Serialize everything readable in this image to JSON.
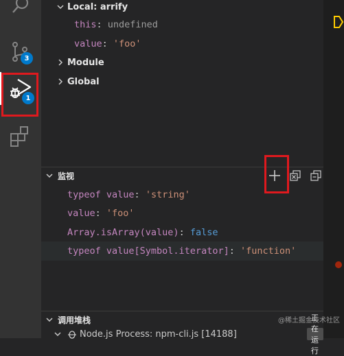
{
  "activity_bar": {
    "run_debug_badge": "1",
    "scm_badge": "3"
  },
  "variables": {
    "local_scope": "Local: arrify",
    "items": [
      {
        "name": "this",
        "sep": ": ",
        "value": "undefined"
      },
      {
        "name": "value",
        "sep": ": ",
        "value": "'foo'"
      }
    ],
    "module_scope": "Module",
    "global_scope": "Global"
  },
  "watch": {
    "title": "监视",
    "expressions": [
      {
        "expr": "typeof value",
        "sep": ": ",
        "value": "'string'"
      },
      {
        "expr": "value",
        "sep": ": ",
        "value": "'foo'"
      },
      {
        "expr": "Array.isArray(value)",
        "sep": ": ",
        "value": "false"
      },
      {
        "expr": "typeof value[Symbol.iterator]",
        "sep": ": ",
        "value": "'function'"
      }
    ]
  },
  "call_stack": {
    "title": "调用堆栈",
    "process": "Node.js Process: npm-cli.js [14188]",
    "status": "正在运行"
  },
  "watermark": "@稀土掘金技术社区",
  "colors": {
    "highlight_box": "#e0191e",
    "badge": "#007acc",
    "string": "#ce9178",
    "keyword": "#569cd6",
    "property": "#c586c0"
  }
}
